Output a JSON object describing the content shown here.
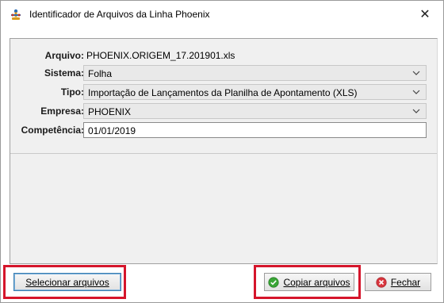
{
  "window": {
    "title": "Identificador de Arquivos da Linha Phoenix",
    "close_glyph": "✕",
    "icon": "phoenix-app-icon"
  },
  "form": {
    "arquivo": {
      "label": "Arquivo:",
      "value": "PHOENIX.ORIGEM_17.201901.xls"
    },
    "sistema": {
      "label": "Sistema:",
      "value": "Folha"
    },
    "tipo": {
      "label": "Tipo:",
      "value": "Importação de Lançamentos da Planilha de Apontamento (XLS)"
    },
    "empresa": {
      "label": "Empresa:",
      "value": "PHOENIX"
    },
    "competencia": {
      "label": "Competência:",
      "value": "01/01/2019"
    }
  },
  "buttons": {
    "select": "Selecionar arquivos",
    "copy": "Copiar arquivos",
    "close": "Fechar"
  },
  "colors": {
    "highlight": "#d5152b",
    "panel": "#f0f0f0",
    "combo": "#e9e9e9",
    "copy_icon": "#3aa637",
    "close_icon": "#d9363e"
  }
}
